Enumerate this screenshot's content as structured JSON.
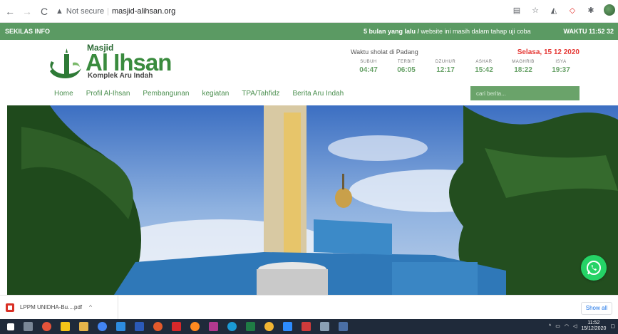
{
  "browser": {
    "warning": "Not secure",
    "url": "masjid-alihsan.org"
  },
  "ticker": {
    "label": "SEKILAS INFO",
    "news_bold": "5 bulan yang lalu /",
    "news_text": " website ini masih dalam tahap uji coba",
    "clock": "WAKTU 11:52 32"
  },
  "logo": {
    "masjid": "Masjid",
    "name": "Al Ihsan",
    "komplek": "Komplek Aru Indah"
  },
  "prayer": {
    "title": "Waktu sholat di Padang",
    "date": "Selasa, 15 12 2020",
    "times": [
      {
        "name": "SUBUH",
        "time": "04:47"
      },
      {
        "name": "TERBIT",
        "time": "06:05"
      },
      {
        "name": "DZUHUR",
        "time": "12:17"
      },
      {
        "name": "ASHAR",
        "time": "15:42"
      },
      {
        "name": "MAGHRIB",
        "time": "18:22"
      },
      {
        "name": "ISYA",
        "time": "19:37"
      }
    ]
  },
  "menu": [
    "Home",
    "Profil Al-Ihsan",
    "Pembangunan",
    "kegiatan",
    "TPA/Tahfidz",
    "Berita Aru Indah"
  ],
  "search": {
    "placeholder": "cari berita..."
  },
  "download": {
    "file": "LPPM UNIDHA-Bu....pdf",
    "show_all": "Show all"
  },
  "taskbar": {
    "time": "11:52",
    "date": "15/12/2020"
  },
  "colors": {
    "brand_green": "#5b9a63",
    "date_red": "#e53935"
  }
}
